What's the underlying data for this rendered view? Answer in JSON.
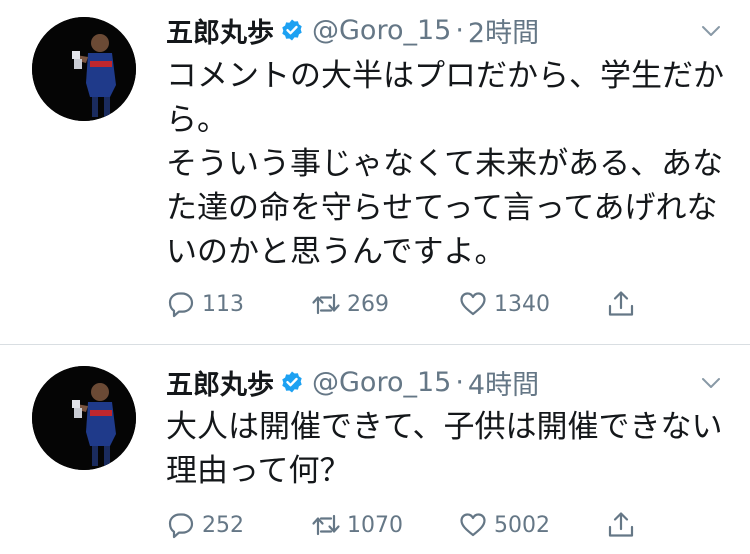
{
  "tweets": [
    {
      "display_name": "五郎丸歩",
      "handle": "@Goro_15",
      "separator": "·",
      "time": "2時間",
      "lines": [
        "コメントの大半はプロだから、学生だから。",
        "そういう事じゃなくて未来がある、あなた達の命を守らせてって言ってあげれないのかと思うんですよ。"
      ],
      "replies": "113",
      "retweets": "269",
      "likes": "1340"
    },
    {
      "display_name": "五郎丸歩",
      "handle": "@Goro_15",
      "separator": "·",
      "time": "4時間",
      "lines": [
        "大人は開催できて、子供は開催できない理由って何？"
      ],
      "replies": "252",
      "retweets": "1070",
      "likes": "5002"
    }
  ],
  "colors": {
    "text": "#14171a",
    "secondary": "#657786",
    "verified": "#1da1f2",
    "divider": "#d9dee2"
  },
  "icons": [
    "verified-badge-icon",
    "chevron-down-icon",
    "reply-icon",
    "retweet-icon",
    "like-icon",
    "share-icon"
  ]
}
